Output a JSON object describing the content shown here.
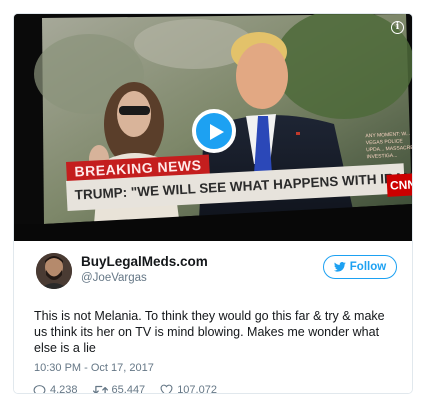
{
  "media": {
    "breaking_label": "BREAKING NEWS",
    "headline": "TRUMP: \"WE WILL SEE WHAT HAPPENS WITH IRAN\"",
    "network_logo": "CNN",
    "side_text": "ANY MOMENT: W... VEGAS POLICE UPDA... MASSACRE INVESTIGA...",
    "info_icon": "i",
    "play_icon": "play-icon"
  },
  "tweet": {
    "display_name": "BuyLegalMeds.com",
    "handle": "@JoeVargas",
    "follow_label": "Follow",
    "text": "This is not Melania. To think they would go this far & try & make us think its her on TV is mind blowing. Makes me wonder what else is a lie",
    "timestamp": "10:30 PM - Oct 17, 2017",
    "stats": {
      "replies": "4,238",
      "retweets": "65,447",
      "likes": "107,072"
    }
  },
  "colors": {
    "accent": "#1da1f2",
    "text": "#14171a",
    "secondary_text": "#657786",
    "border": "#e1e8ed",
    "breaking_red": "#c41e1e"
  }
}
